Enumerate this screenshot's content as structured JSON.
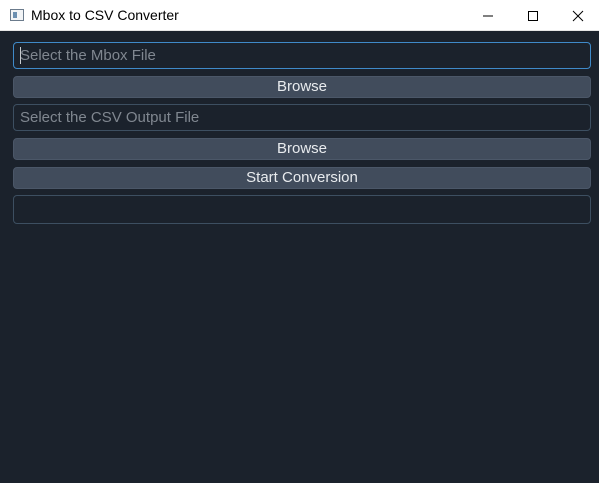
{
  "window": {
    "title": "Mbox to CSV Converter",
    "controls": {
      "minimize_icon": "minimize-icon",
      "maximize_icon": "maximize-icon",
      "close_icon": "close-icon"
    }
  },
  "form": {
    "mbox_input": {
      "placeholder": "Select the Mbox File",
      "value": ""
    },
    "mbox_browse_label": "Browse",
    "csv_input": {
      "placeholder": "Select the CSV Output File",
      "value": ""
    },
    "csv_browse_label": "Browse",
    "start_label": "Start Conversion",
    "status_text": ""
  },
  "colors": {
    "background": "#1b222c",
    "button": "#414c5c",
    "focus_border": "#3f8ac9",
    "field_border": "#3d4f61"
  }
}
